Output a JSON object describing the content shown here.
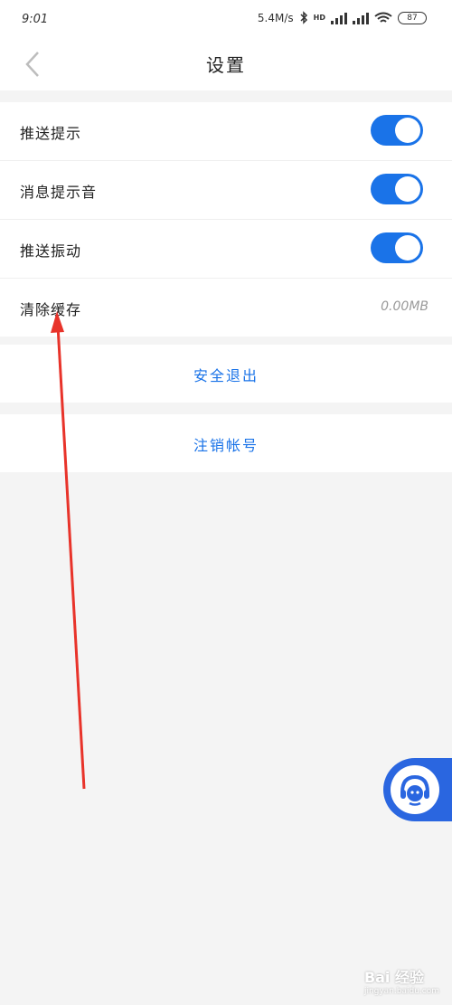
{
  "status_bar": {
    "time": "9:01",
    "net_speed": "5.4M/s",
    "hd_label": "HD",
    "battery": "87"
  },
  "header": {
    "title": "设置"
  },
  "settings": [
    {
      "label": "推送提示",
      "type": "toggle",
      "on": true
    },
    {
      "label": "消息提示音",
      "type": "toggle",
      "on": true
    },
    {
      "label": "推送振动",
      "type": "toggle",
      "on": true
    },
    {
      "label": "清除缓存",
      "type": "value",
      "value": "0.00MB"
    }
  ],
  "actions": {
    "logout": "安全退出",
    "deactivate": "注销帐号"
  },
  "watermark": {
    "brand": "Bai 经验",
    "sub": "jingyan.baidu.com"
  },
  "colors": {
    "accent": "#1a73e8",
    "annotation": "#e8332a"
  }
}
